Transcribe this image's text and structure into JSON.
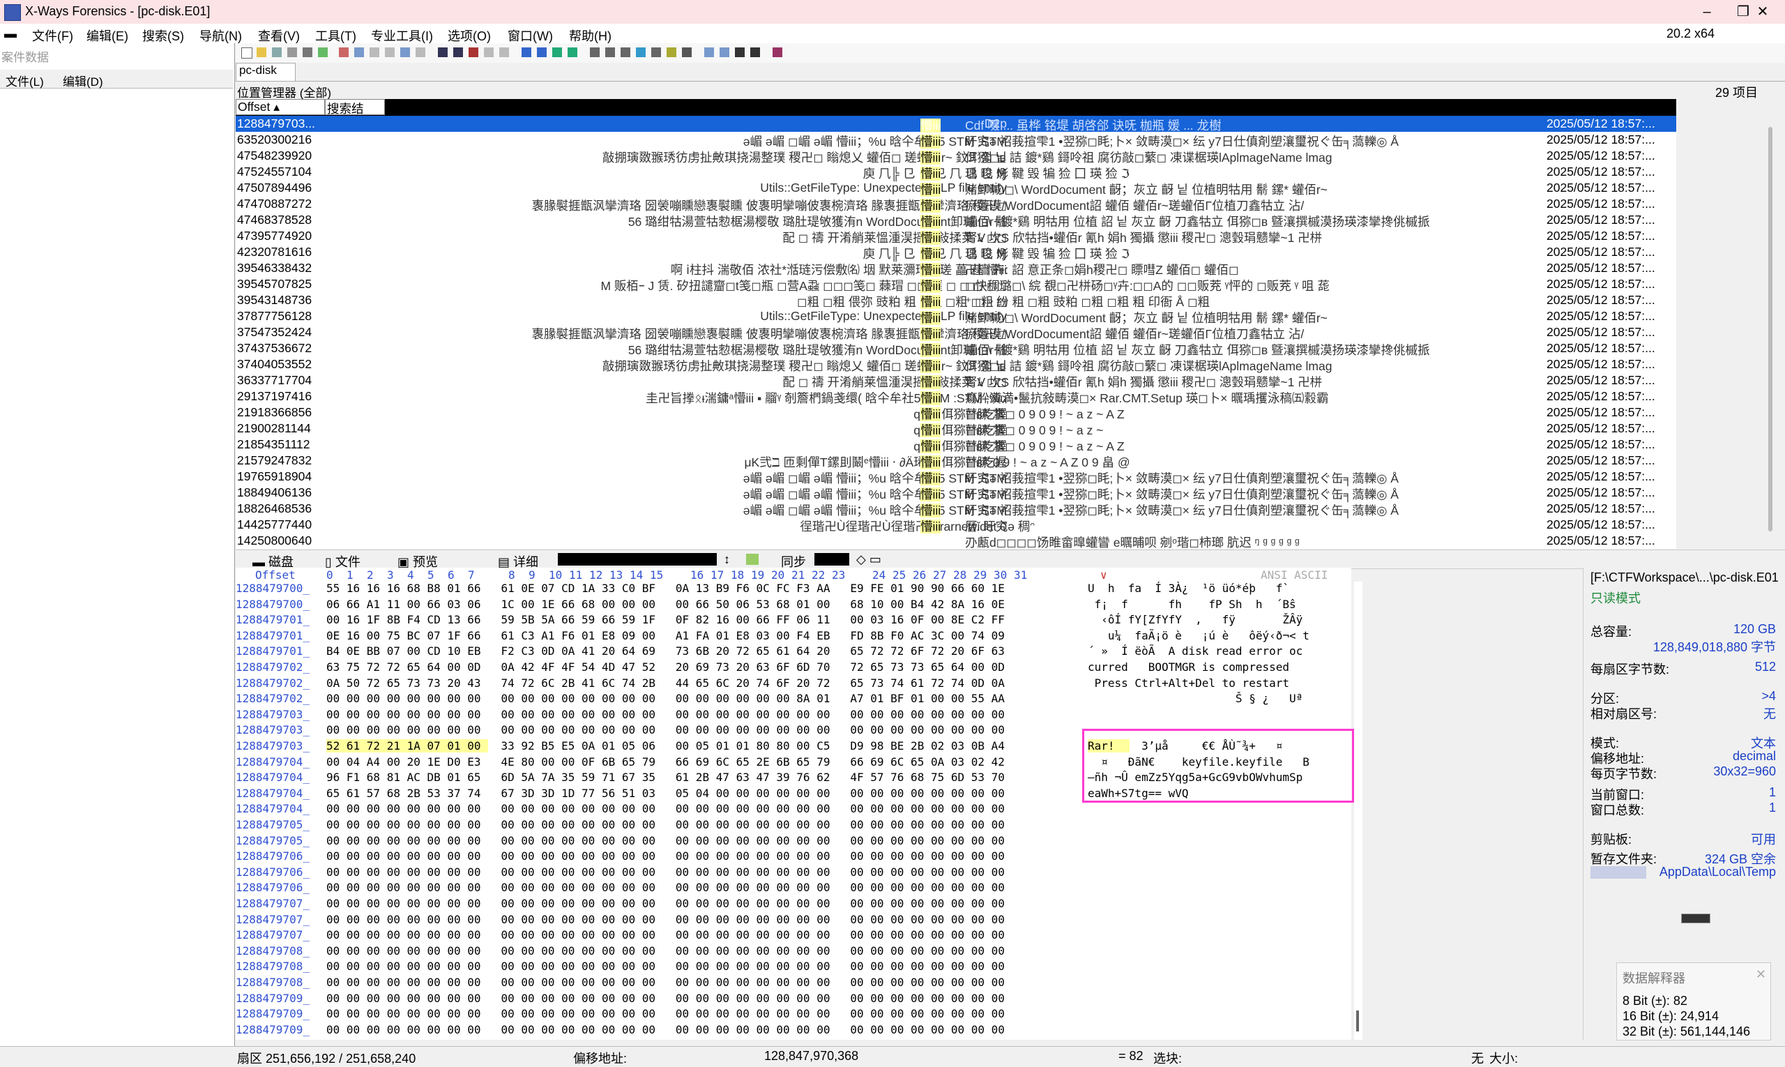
{
  "window": {
    "title": "X-Ways Forensics - [pc-disk.E01]",
    "version": "20.2 x64",
    "minimize": "–",
    "restore": "❐",
    "close": "✕"
  },
  "menu": [
    "文件(F)",
    "编辑(E)",
    "搜索(S)",
    "导航(N)",
    "查看(V)",
    "工具(T)",
    "专业工具(I)",
    "选项(O)",
    "窗口(W)",
    "帮助(H)"
  ],
  "left_pane": {
    "header": "案件数据",
    "menu": [
      "文件(L)",
      "编辑(D)"
    ]
  },
  "tab": "pc-disk",
  "dir_line": "位置管理器 (全部)",
  "item_count": "29 项目",
  "list_headers": {
    "offset": "Offset",
    "search": "搜索结"
  },
  "rows": [
    {
      "offset": "1288479703...",
      "snip": "D2p",
      "hit": "懵iii",
      "tail": "Cdf 嗫 ... 虽桦 铭堤 胡啓郃 诀呒 枷瓶 媛 ... 龙樹",
      "date": "2025/05/12   18:57:..."
    },
    {
      "offset": "63520300216",
      "snip": "ǝ嵋 ǝ嵋 ◻嵋 ǝ嵋 懵iii；%u 晗仐牟社5  STM :STM",
      "hit": "懵iii",
      "tail": "盱究ǝ  袑莪揎雫1 •翌猕◻眊;卜× 敛畴漠◻× 纭  у7日仕傎剤塑瀼璽祝ぐ缶╕薃轢◎ Å",
      "date": "2025/05/12   18:57:..."
    },
    {
      "offset": "47548239920",
      "snip": "敲掤璌敪翭琇彷虏扯敟琪挠湯整璞 稷卍◻ 瞈熄乂 蠸佰◻ 瑳蠸佰r~  鈫ℱ 쩗  닡",
      "hit": "懵iii",
      "tail": "佴猕◻ʙ  詰 鍍*鷄   鎶呤祖  腐彷敲◻蘩◻ 凍谍椐瑛lAplmageName  lmag",
      "date": "2025/05/12   18:57:..."
    },
    {
      "offset": "47524557104",
      "snip": "   庾  ⺇╠  ⺋ ⺋ ⺋   ⺇  ⺋ ⺋ Ɱ",
      "hit": "懵iii",
      "tail": "   瑀 晙  烿 鞬  毁  犏  猃  ⼞  瑛  猃  ℑ",
      "date": "2025/05/12   18:57:..."
    },
    {
      "offset": "47507894496",
      "snip": "Utils::GetFileType: Unexpected DLP file entity",
      "hit": "懵iii",
      "tail": "赌卸瑊ι◻\\ WordDocument 齖；灰立 齖  닡    位植明牯用 鬋 鏍* 蠸佰r~",
      "date": "2025/05/12   18:57:..."
    },
    {
      "offset": "47470887272",
      "snip": "褢腞褽捱甑沨攣濟珞   圀褮嘣矄戀褢褽矄    佊褢明攣嘣佊褢椀濟珞 腞褢捱甑沨攣濟珞 稷卍◻",
      "hit": "懵iii",
      "tail": "瘀蘧漠/WordDocument詔 蠸佰 蠸佰r~瑳蠸佰Γ位植刀鑫牯立 沾/",
      "date": "2025/05/12   18:57:..."
    },
    {
      "offset": "47468378528",
      "snip": "56  璐绀牯湯萱牯愸椐湯樱敬 璐肚瑅敂獲洧n  WordDocument卸瑊ι◻\\ 鬋",
      "hit": "懵iii",
      "tail": "蠸佰r~鍍*鷄 明牯用 位植 詔 닡  灰立 齖   刀鑫牯立 佴猕◻ʙ 曁瀼撰槭漠扬瑛漆攣搀佻槭挀",
      "date": "2025/05/12   18:57:..."
    },
    {
      "offset": "47395774920",
      "snip": "配  ◻         禱       开淆艄莱慍湩淏摇牯敍揉荚      ﾑ ◻◻",
      "hit": "懵iii",
      "tail": "腎V  坎S  欣牯挡•蠸佰r 氰h  娟h  獨攝  懲iii  稷卍◻ 漗瑴琄戆攣~1  卍栟",
      "date": "2025/05/12   18:57:..."
    },
    {
      "offset": "42320781616",
      "snip": "   庾  ⺇╠  ⺋ ⺋ ⺋   ⺇  ⺋ ⺋ Ɱ",
      "hit": "懵iii",
      "tail": "   瑀 晙  烿 鞬  毁  犏  猃  ⼞  瑛  猃  ℑ",
      "date": "2025/05/12   18:57:..."
    },
    {
      "offset": "39546338432",
      "snip": "啊 ⅰ柱抖  湍敬佰   浓社*湉琏污偿敷㈴ 㘻 默莱瀰瑁湉瑳 藟  蓕     懵iii",
      "hit": "懵iii",
      "tail": "   卍樯     卉:  詔      意正条◻娟h稷卍◻ 瞟嘒Z 蠸佰◻  蠸佰◻",
      "date": "2025/05/12   18:57:..."
    },
    {
      "offset": "39545707825",
      "snip": "M 贩栢ｰ   J 赁.   矽扭譴齏◻t笺◻瓶  ◻营A蝨 ◻◻◻笺◻ 蕀瑁 ◻◻ 蘁 ◻ ◻ ◻  ◻◻",
      "hit": "懵iii",
      "tail": "◻快稠璐◻\\ 綄 覩◻卍栟砀◻ᵞ卉:◻◻A的  ◻◻贩茺   ᵞ怦的   ◻贩茺  ᵞ 咀 蒊",
      "date": "2025/05/12   18:57:..."
    },
    {
      "offset": "39543148736",
      "snip": "◻粗   ◻粗     偎弥       豉粕   粗  ◻粗  ◻粗  ◻粗  ◻",
      "hit": "懵iii",
      "tail": "  ⁺ ◻  ᵕ 紛  粗  ◻粗  豉粕  ◻粗  ◻粗  粗  印衙  Å  ◻粗",
      "date": "2025/05/12   18:57:..."
    },
    {
      "offset": "37877756128",
      "snip": "Utils::GetFileType: Unexpected DLP file entity",
      "hit": "懵iii",
      "tail": "赌卸瑊ι◻\\ WordDocument 齖；灰立 齖  닡    位植明牯用 鬋 鏍* 蠸佰r~",
      "date": "2025/05/12   18:57:..."
    },
    {
      "offset": "37547352424",
      "snip": "褢腞褽捱甑沨攣濟珞   圀褮嘣矄戀褢褽矄    佊褢明攣嘣佊褢椀濟珞 腞褢捱甑沨攣濟珞 稷卍◻",
      "hit": "懵iii",
      "tail": "瘀蘧漠/WordDocument詔 蠸佰 蠸佰r~瑳蠸佰Γ位植刀鑫牯立 沾/",
      "date": "2025/05/12   18:57:..."
    },
    {
      "offset": "37437536672",
      "snip": "56  璐绀牯湯萱牯愸椐湯樱敬 璐肚瑅敂獲洧n  WordDocument卸瑊ι◻\\ 鬋",
      "hit": "懵iii",
      "tail": "蠸佰r~鍍*鷄 明牯用 位植 詔 닡  灰立 齖   刀鑫牯立 佴猕◻ʙ 曁瀼撰槭漠扬瑛漆攣搀佻槭挀",
      "date": "2025/05/12   18:57:..."
    },
    {
      "offset": "37404053552",
      "snip": "敲掤璌敪翭琇彷虏扯敟琪挠湯整璞 稷卍◻ 瞈熄乂 蠸佰◻ 瑳蠸佰r~  鈫ℱ 쩗  닡",
      "hit": "懵iii",
      "tail": "佴猕◻ʙ  詰 鍍*鷄   鎶呤祖  腐彷敲◻蘩◻ 凍谍椐瑛lAplmageName  lmag",
      "date": "2025/05/12   18:57:..."
    },
    {
      "offset": "36337717704",
      "snip": "配  ◻         禱       开淆艄莱慍湩淏摇牯敍揉荚      ﾑ ◻◻",
      "hit": "懵iii",
      "tail": "腎V  坎S  欣牯挡•蠸佰r 氰h  娟h  獨攝  懲iii  稷卍◻ 漗瑴琄戆攣~1  卍栟",
      "date": "2025/05/12   18:57:..."
    },
    {
      "offset": "29137197416",
      "snip": "圭卍旨搼ᛟᵻ湍鏞ᵃ懵iii ▪ 鬸ᵞ  剞簷椚鍋戔缳(  晗仐牟社5   STM :STM   ;%u",
      "hit": "懵iii",
      "tail": "  瘍肸瀵満•鬛抗敍畴漠◻× Rar.CMT.Setup  瑛◻卜× 曞瑀攫泳稿㈤縠霸",
      "date": "2025/05/12   18:57:..."
    },
    {
      "offset": "21918366856",
      "snip": "q                         A   (      佴猕◻ʙ吃握",
      "hit": "懵iii",
      "tail": "瞽膆  掌◻             0 9      0 9 ! ~ a z  ~ A Z",
      "date": "2025/05/12   18:57:..."
    },
    {
      "offset": "21900281144",
      "snip": "q                         A   (      佴猕◻ʙ吃握",
      "hit": "懵iii",
      "tail": "瞽膆  掌◻              0 9    0 9 ! ~ a z  ~",
      "date": "2025/05/12   18:57:..."
    },
    {
      "offset": "21854351112",
      "snip": "q                         A   (      佴猕◻ʙ吃握",
      "hit": "懵iii",
      "tail": "瞽膆  掌◻          0 9    0 9 ! ~ a z  ~ A Z",
      "date": "2025/05/12   18:57:..."
    },
    {
      "offset": "21579247832",
      "snip": "μΚ弐ℶ 匝剩僤T鏍刞鬫ᵉ懵iii ‧ ∂Ä琋ˉˉˉ  佴猕◻ʙ吃握",
      "hit": "懵iii",
      "tail": "瞽膆          0 9 ! ~ a z  ~ A Z 0 9 畠     @",
      "date": "2025/05/12   18:57:..."
    },
    {
      "offset": "19765918904",
      "snip": "ǝ嵋 ǝ嵋 ◻嵋 ǝ嵋 懵iii；%u 晗仐牟社5  STM :STM",
      "hit": "懵iii",
      "tail": "盱究ǝ  袑莪揎雫1 •翌猕◻眊;卜× 敛畴漠◻× 纭  у7日仕傎剤塑瀼璽祝ぐ缶╕薃轢◎ Å",
      "date": "2025/05/12   18:57:..."
    },
    {
      "offset": "18849406136",
      "snip": "ǝ嵋 ǝ嵋 ◻嵋 ǝ嵋 懵iii；%u 晗仐牟社5  STM :STM",
      "hit": "懵iii",
      "tail": "盱究ǝ  袑莪揎雫1 •翌猕◻眊;卜× 敛畴漠◻× 纭  у7日仕傎剤塑瀼璽祝ぐ缶╕薃轢◎ Å",
      "date": "2025/05/12   18:57:..."
    },
    {
      "offset": "18826468536",
      "snip": "ǝ嵋 ǝ嵋 ◻嵋 ǝ嵋 懵iii；%u 晗仐牟社5  STM :STM",
      "hit": "懵iii",
      "tail": "盱究ǝ  袑莪揎雫1 •翌猕◻眊;卜× 敛畴漠◻× 纭  у7日仕傎剤塑瀼璽祝ぐ缶╕薃轢◎ Å",
      "date": "2025/05/12   18:57:..."
    },
    {
      "offset": "14425777440",
      "snip": "徎瑎卍Ù徎瑎卍Ù徎瑎卍Ù          rarnew.dat  0",
      "hit": "懵iii",
      "tail": "   曆ǐ 盱究ǝ  稠ᵔ",
      "date": "2025/05/12   18:57:..."
    },
    {
      "offset": "14250800640",
      "snip": "",
      "hit": "",
      "tail": "刅㼺d◻◻◻◻饧睢畲曍蠸矕   е曞晡呗 剜ᵒ瑎◻柿瑯 肮迟 ᵑ  ᵍ  ᵍ  ᵍ  ᵍ  ᵍ",
      "date": "2025/05/12   18:57:..."
    }
  ],
  "bottom_tabs": {
    "disk": "磁盘",
    "file": "文件",
    "preview": "预览",
    "detail": "详细",
    "sync": "同步"
  },
  "hex_header": {
    "offset": "Offset",
    "cols": [
      "0",
      "1",
      "2",
      "3",
      "4",
      "5",
      "6",
      "7",
      "8",
      "9",
      "10",
      "11",
      "12",
      "13",
      "14",
      "15",
      "16",
      "17",
      "18",
      "19",
      "20",
      "21",
      "22",
      "23",
      "24",
      "25",
      "26",
      "27",
      "28",
      "29",
      "30",
      "31"
    ],
    "ansi": "ANSI ASCII"
  },
  "hex_rows": [
    {
      "o": "1288479700_",
      "b": "55 16 16 16 68 B8 01 66   61 0E 07 CD 1A 33 C0 BF   0A 13 B9 F6 0C FC F3 AA   E9 FE 01 90 90 66 60 1E",
      "a": "U  h  fa  Í 3À¿  ¹ö üó*éþ   f`"
    },
    {
      "o": "1288479700_",
      "b": "06 66 A1 11 00 66 03 06   1C 00 1E 66 68 00 00 00   00 66 50 06 53 68 01 00   68 10 00 B4 42 8A 16 0E",
      "a": " f¡  f      fh    fP Sh  h  ´Bŝ "
    },
    {
      "o": "1288479701_",
      "b": "00 16 1F 8B F4 CD 13 66   59 5B 5A 66 59 66 59 1F   0F 82 16 00 66 FF 06 11   00 03 16 0F 00 8E C2 FF",
      "a": "  ‹ôÍ fY[ZfYfY  ‚   fÿ       ŽÂÿ"
    },
    {
      "o": "1288479701_",
      "b": "0E 16 00 75 BC 07 1F 66   61 C3 A1 F6 01 E8 09 00   A1 FA 01 E8 03 00 F4 EB   FD 8B F0 AC 3C 00 74 09",
      "a": "   u¼  faÃ¡ö è   ¡ú è   ôëý‹ð¬< t "
    },
    {
      "o": "1288479701_",
      "b": "B4 0E BB 07 00 CD 10 EB   F2 C3 0D 0A 41 20 64 69   73 6B 20 72 65 61 64 20   65 72 72 6F 72 20 6F 63",
      "a": "´ »  Í ëòÃ  A disk read error oc"
    },
    {
      "o": "1288479702_",
      "b": "63 75 72 72 65 64 00 0D   0A 42 4F 4F 54 4D 47 52   20 69 73 20 63 6F 6D 70   72 65 73 73 65 64 00 0D",
      "a": "curred   BOOTMGR is compressed   "
    },
    {
      "o": "1288479702_",
      "b": "0A 50 72 65 73 73 20 43   74 72 6C 2B 41 6C 74 2B   44 65 6C 20 74 6F 20 72   65 73 74 61 72 74 0D 0A",
      "a": " Press Ctrl+Alt+Del to restart  "
    },
    {
      "o": "1288479702_",
      "b": "00 00 00 00 00 00 00 00   00 00 00 00 00 00 00 00   00 00 00 00 00 00 8A 01   A7 01 BF 01 00 00 55 AA",
      "a": "                      Š § ¿   Uª"
    },
    {
      "o": "1288479703_",
      "b": "00 00 00 00 00 00 00 00   00 00 00 00 00 00 00 00   00 00 00 00 00 00 00 00   00 00 00 00 00 00 00 00",
      "a": ""
    },
    {
      "o": "1288479703_",
      "b": "00 00 00 00 00 00 00 00   00 00 00 00 00 00 00 00   00 00 00 00 00 00 00 00   00 00 00 00 00 00 00 00",
      "a": ""
    },
    {
      "o": "1288479703_",
      "b": "52 61 72 21 1A 07 01 00   33 92 B5 E5 0A 01 05 06   00 05 01 01 80 80 00 C5   D9 98 BE 2B 02 03 0B A4",
      "a": "Rar!    3’µå     €€ ÅÙ˜¾+   ¤"
    },
    {
      "o": "1288479704_",
      "b": "00 04 A4 00 20 1E D0 E3   4E 80 00 00 0F 6B 65 79   66 69 6C 65 2E 6B 65 79   66 69 6C 65 0A 03 02 42",
      "a": "  ¤   ÐãN€    keyfile.keyfile   B"
    },
    {
      "o": "1288479704_",
      "b": "96 F1 68 81 AC DB 01 65   6D 5A 7A 35 59 71 67 35   61 2B 47 63 47 39 76 62   4F 57 76 68 75 6D 53 70",
      "a": "–ñh ¬Û emZz5Yqg5a+GcG9vbOWvhumSp"
    },
    {
      "o": "1288479704_",
      "b": "65 61 57 68 2B 53 37 74   67 3D 3D 1D 77 56 51 03   05 04 00 00 00 00 00 00   00 00 00 00 00 00 00 00",
      "a": "eaWh+S7tg== wVQ"
    },
    {
      "o": "1288479704_",
      "b": "00 00 00 00 00 00 00 00   00 00 00 00 00 00 00 00   00 00 00 00 00 00 00 00   00 00 00 00 00 00 00 00",
      "a": ""
    },
    {
      "o": "1288479705_",
      "b": "00 00 00 00 00 00 00 00   00 00 00 00 00 00 00 00   00 00 00 00 00 00 00 00   00 00 00 00 00 00 00 00",
      "a": ""
    },
    {
      "o": "1288479705_",
      "b": "00 00 00 00 00 00 00 00   00 00 00 00 00 00 00 00   00 00 00 00 00 00 00 00   00 00 00 00 00 00 00 00",
      "a": ""
    },
    {
      "o": "1288479706_",
      "b": "00 00 00 00 00 00 00 00   00 00 00 00 00 00 00 00   00 00 00 00 00 00 00 00   00 00 00 00 00 00 00 00",
      "a": ""
    },
    {
      "o": "1288479706_",
      "b": "00 00 00 00 00 00 00 00   00 00 00 00 00 00 00 00   00 00 00 00 00 00 00 00   00 00 00 00 00 00 00 00",
      "a": ""
    },
    {
      "o": "1288479706_",
      "b": "00 00 00 00 00 00 00 00   00 00 00 00 00 00 00 00   00 00 00 00 00 00 00 00   00 00 00 00 00 00 00 00",
      "a": ""
    },
    {
      "o": "1288479707_",
      "b": "00 00 00 00 00 00 00 00   00 00 00 00 00 00 00 00   00 00 00 00 00 00 00 00   00 00 00 00 00 00 00 00",
      "a": ""
    },
    {
      "o": "1288479707_",
      "b": "00 00 00 00 00 00 00 00   00 00 00 00 00 00 00 00   00 00 00 00 00 00 00 00   00 00 00 00 00 00 00 00",
      "a": ""
    },
    {
      "o": "1288479707_",
      "b": "00 00 00 00 00 00 00 00   00 00 00 00 00 00 00 00   00 00 00 00 00 00 00 00   00 00 00 00 00 00 00 00",
      "a": ""
    },
    {
      "o": "1288479708_",
      "b": "00 00 00 00 00 00 00 00   00 00 00 00 00 00 00 00   00 00 00 00 00 00 00 00   00 00 00 00 00 00 00 00",
      "a": ""
    },
    {
      "o": "1288479708_",
      "b": "00 00 00 00 00 00 00 00   00 00 00 00 00 00 00 00   00 00 00 00 00 00 00 00   00 00 00 00 00 00 00 00",
      "a": ""
    },
    {
      "o": "1288479708_",
      "b": "00 00 00 00 00 00 00 00   00 00 00 00 00 00 00 00   00 00 00 00 00 00 00 00   00 00 00 00 00 00 00 00",
      "a": ""
    },
    {
      "o": "1288479709_",
      "b": "00 00 00 00 00 00 00 00   00 00 00 00 00 00 00 00   00 00 00 00 00 00 00 00   00 00 00 00 00 00 00 00",
      "a": ""
    },
    {
      "o": "1288479709_",
      "b": "00 00 00 00 00 00 00 00   00 00 00 00 00 00 00 00   00 00 00 00 00 00 00 00   00 00 00 00 00 00 00 00",
      "a": ""
    },
    {
      "o": "1288479709_",
      "b": "00 00 00 00 00 00 00 00   00 00 00 00 00 00 00 00   00 00 00 00 00 00 00 00   00 00 00 00 00 00 00 00",
      "a": ""
    }
  ],
  "info": {
    "path": "[F:\\CTFWorkspace\\...\\pc-disk.E01",
    "mode_ro": "只读模式",
    "total_label": "总容量:",
    "total_gb": "120 GB",
    "total_bytes": "128,849,018,880 字节",
    "bps_label": "每扇区字节数:",
    "bps": "512",
    "part_label": "分区:",
    "part": ">4",
    "relsec_label": "相对扇区号:",
    "relsec": "无",
    "mode_label": "模式:",
    "mode": "文本",
    "offaddr_label": "偏移地址:",
    "offaddr": "decimal",
    "perpage_label": "每页字节数:",
    "perpage": "30x32=960",
    "curwin_label": "当前窗口:",
    "curwin": "1",
    "wintotal_label": "窗口总数:",
    "wintotal": "1",
    "clip_label": "剪贴板:",
    "clip": "可用",
    "temp_label": "暂存文件夹:",
    "temp_free": "324 GB 空余",
    "temp_path": "AppData\\Local\\Temp"
  },
  "interpreter": {
    "title": "数据解释器",
    "b8": "8 Bit (±): 82",
    "b16": "16 Bit (±): 24,914",
    "b32": "32 Bit (±): 561,144,146"
  },
  "status": {
    "sector": "扇区 251,656,192 / 251,658,240",
    "offset_label": "偏移地址:",
    "offset": "128,847,970,368",
    "value": "= 82",
    "sel_label": "选块:",
    "none": "无",
    "size_label": "大小:"
  }
}
